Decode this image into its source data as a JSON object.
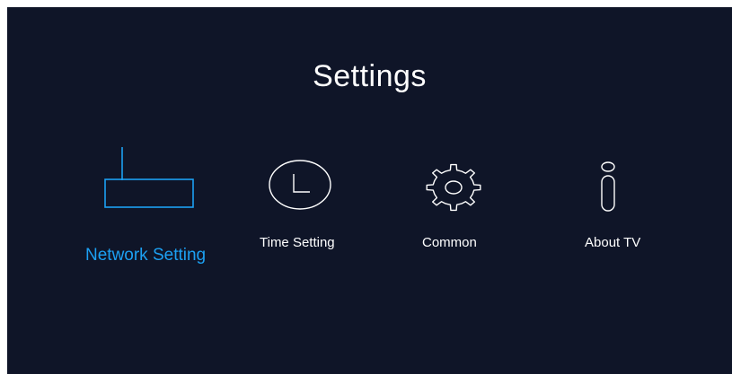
{
  "page": {
    "title": "Settings"
  },
  "colors": {
    "background": "#0f1528",
    "text": "#ffffff",
    "accent": "#1ca0f2"
  },
  "menu": {
    "selected_index": 0,
    "items": [
      {
        "label": "Network Setting",
        "icon": "router-icon"
      },
      {
        "label": "Time Setting",
        "icon": "clock-icon"
      },
      {
        "label": "Common",
        "icon": "gear-icon"
      },
      {
        "label": "About TV",
        "icon": "info-icon"
      }
    ]
  }
}
